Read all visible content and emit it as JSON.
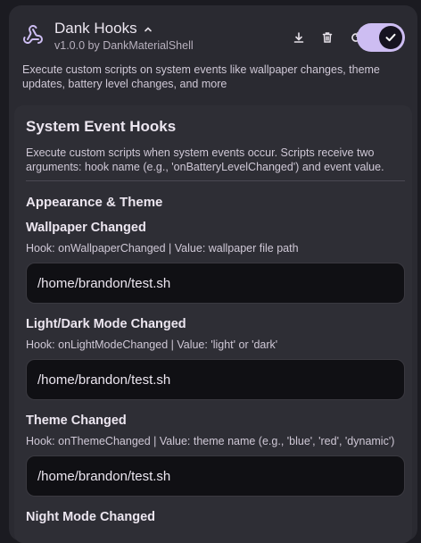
{
  "plugin": {
    "title": "Dank Hooks",
    "version_line": "v1.0.0 by DankMaterialShell",
    "description": "Execute custom scripts on system events like wallpaper changes, theme updates, battery level changes, and more",
    "enabled": true,
    "icons": {
      "logo": "webhook-icon",
      "expand": "chevron-up-icon",
      "download": "download-icon",
      "delete": "trash-icon",
      "reload": "refresh-icon",
      "toggle": "check-icon"
    },
    "accent_color": "#cdbdf2"
  },
  "section": {
    "title": "System Event Hooks",
    "description": "Execute custom scripts when system events occur. Scripts receive two arguments: hook name (e.g., 'onBatteryLevelChanged') and event value.",
    "group_title": "Appearance & Theme"
  },
  "hooks": [
    {
      "title": "Wallpaper Changed",
      "info": "Hook: onWallpaperChanged | Value: wallpaper file path",
      "value": "/home/brandon/test.sh"
    },
    {
      "title": "Light/Dark Mode Changed",
      "info": "Hook: onLightModeChanged | Value: 'light' or 'dark'",
      "value": "/home/brandon/test.sh"
    },
    {
      "title": "Theme Changed",
      "info": "Hook: onThemeChanged | Value: theme name (e.g., 'blue', 'red', 'dynamic')",
      "value": "/home/brandon/test.sh"
    },
    {
      "title": "Night Mode Changed"
    }
  ]
}
